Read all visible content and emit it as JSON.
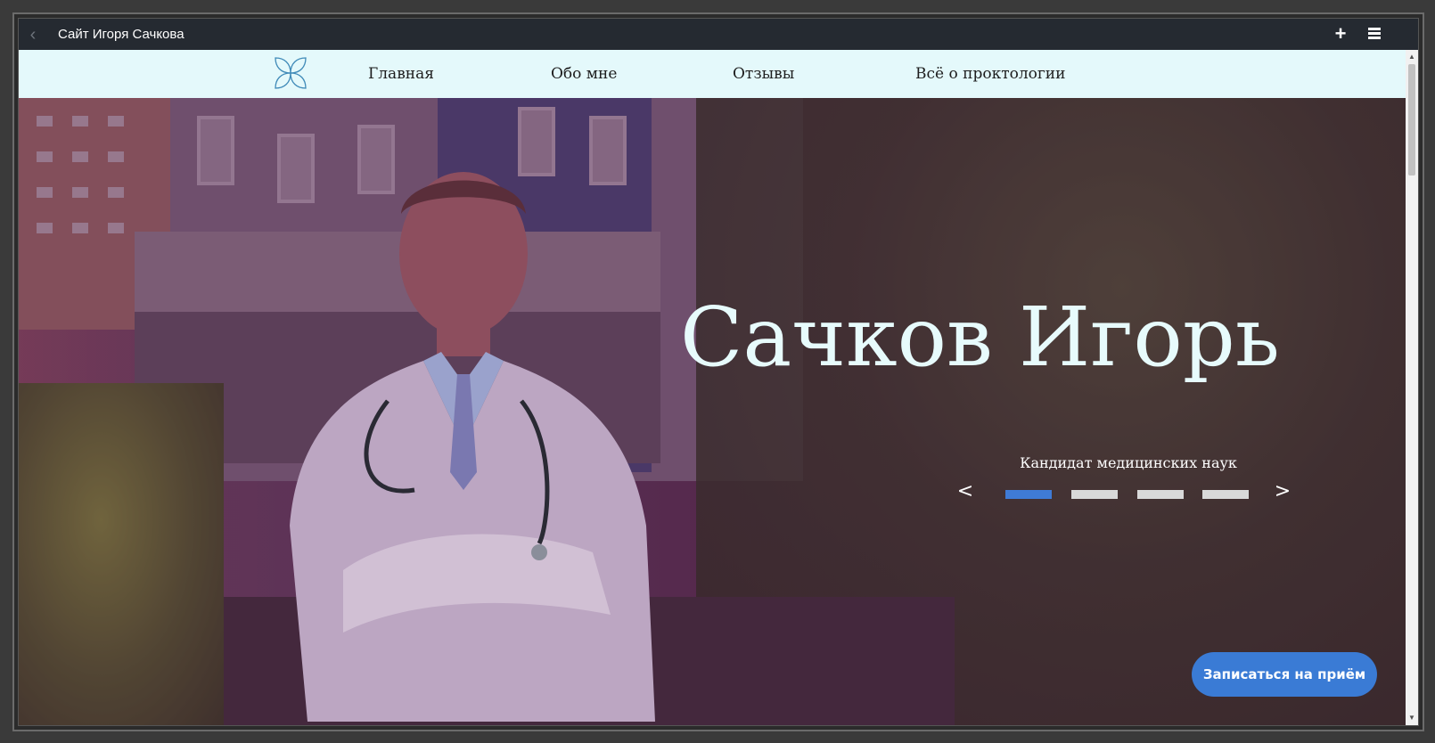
{
  "window": {
    "title": "Сайт Игоря Сачкова",
    "back_icon": "chevron-left-icon",
    "plus_icon": "plus-icon",
    "menu_icon": "hamburger-menu-icon"
  },
  "nav": {
    "logo_icon": "flower-logo-icon",
    "items": [
      {
        "label": "Главная"
      },
      {
        "label": "Обо мне"
      },
      {
        "label": "Отзывы"
      },
      {
        "label": "Всё о проктологии"
      }
    ]
  },
  "hero": {
    "title": "Сачков Игорь",
    "subtitle": "Кандидат медицинских наук",
    "slider": {
      "prev_label": "<",
      "next_label": ">",
      "active_index": 0,
      "count": 4
    },
    "cta_label": "Записаться на приём"
  },
  "colors": {
    "nav_bg": "#e4f9fb",
    "accent": "#3a7bd5",
    "title_color": "#e7fbfc"
  }
}
